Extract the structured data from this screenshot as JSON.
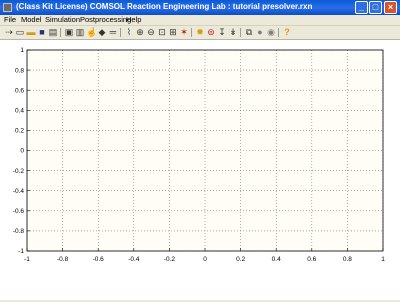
{
  "window": {
    "title": "(Class Kit License) COMSOL Reaction Engineering Lab : tutorial presolver.rxn",
    "minimize_glyph": "_",
    "maximize_glyph": "□",
    "close_glyph": "×"
  },
  "menu": {
    "file": "File",
    "model": "Model",
    "simulation": "Simulation",
    "postprocessing": "Postprocessing",
    "help": "Help"
  },
  "toolbar_icons": [
    "reaction-arrow-icon",
    "new-file-icon",
    "open-folder-icon",
    "save-icon",
    "print-icon",
    "model-settings-icon",
    "chart-settings-icon",
    "hand-pointer-icon",
    "species-icon",
    "equals-icon",
    "plot-icon",
    "zoom-in-icon",
    "zoom-out-icon",
    "zoom-window-icon",
    "zoom-extents-icon",
    "reset-view-icon",
    "solver-settings-icon",
    "compute-icon",
    "compute-step-icon",
    "compute-icon-2",
    "export-icon",
    "import-icon",
    "plot-parameters-icon",
    "help-icon"
  ],
  "chart_data": {
    "type": "line",
    "title": "",
    "xlabel": "",
    "ylabel": "",
    "xlim": [
      -1,
      1
    ],
    "ylim": [
      -1,
      1
    ],
    "grid": true,
    "xticks": [
      "-1",
      "-0.8",
      "-0.6",
      "-0.4",
      "-0.2",
      "0",
      "0.2",
      "0.4",
      "0.6",
      "0.8",
      "1"
    ],
    "yticks": [
      "1",
      "0.8",
      "0.6",
      "0.4",
      "0.2",
      "0",
      "-0.2",
      "-0.4",
      "-0.6",
      "-0.8",
      "-1"
    ],
    "series": []
  }
}
